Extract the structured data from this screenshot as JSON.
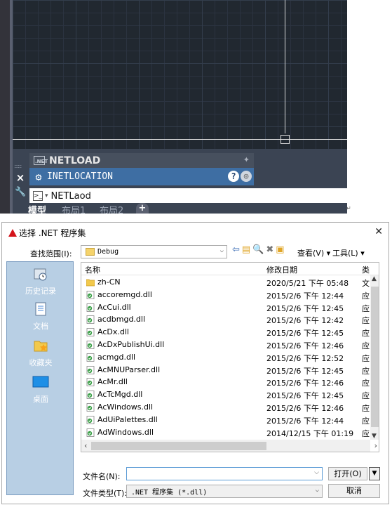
{
  "acad": {
    "panel_title": "NETLOAD",
    "panel_icon_text": ".NET",
    "suggestion": "INETLOCATION",
    "command_text": "NETLaod",
    "tabs": [
      "模型",
      "布局1",
      "布局2"
    ],
    "add_tab": "+",
    "close_glyph": "×"
  },
  "dialog": {
    "title": "选择 .NET 程序集",
    "lookin_label": "查找范围(I):",
    "lookin_value": "Debug",
    "view_menu": "查看(V) ▾",
    "tools_menu": "工具(L) ▾",
    "places": [
      "历史记录",
      "文档",
      "收藏夹",
      "桌面"
    ],
    "columns": {
      "name": "名称",
      "date": "修改日期",
      "type": "类"
    },
    "files": [
      {
        "name": "zh-CN",
        "date": "2020/5/21 下午 05:48",
        "type": "文",
        "folder": true
      },
      {
        "name": "accoremgd.dll",
        "date": "2015/2/6 下午 12:44",
        "type": "应",
        "folder": false
      },
      {
        "name": "AcCui.dll",
        "date": "2015/2/6 下午 12:45",
        "type": "应",
        "folder": false
      },
      {
        "name": "acdbmgd.dll",
        "date": "2015/2/6 下午 12:42",
        "type": "应",
        "folder": false
      },
      {
        "name": "AcDx.dll",
        "date": "2015/2/6 下午 12:45",
        "type": "应",
        "folder": false
      },
      {
        "name": "AcDxPublishUi.dll",
        "date": "2015/2/6 下午 12:46",
        "type": "应",
        "folder": false
      },
      {
        "name": "acmgd.dll",
        "date": "2015/2/6 下午 12:52",
        "type": "应",
        "folder": false
      },
      {
        "name": "AcMNUParser.dll",
        "date": "2015/2/6 下午 12:45",
        "type": "应",
        "folder": false
      },
      {
        "name": "AcMr.dll",
        "date": "2015/2/6 下午 12:46",
        "type": "应",
        "folder": false
      },
      {
        "name": "AcTcMgd.dll",
        "date": "2015/2/6 下午 12:45",
        "type": "应",
        "folder": false
      },
      {
        "name": "AcWindows.dll",
        "date": "2015/2/6 下午 12:46",
        "type": "应",
        "folder": false
      },
      {
        "name": "AdUiPalettes.dll",
        "date": "2015/2/6 下午 12:44",
        "type": "应",
        "folder": false
      },
      {
        "name": "AdWindows.dll",
        "date": "2014/12/15 下午 01:19",
        "type": "应",
        "folder": false
      }
    ],
    "filename_label": "文件名(N):",
    "filename_value": "",
    "filetype_label": "文件类型(T):",
    "filetype_value": ".NET 程序集 (*.dll)",
    "open_label": "打开(O)",
    "cancel_label": "取消"
  }
}
